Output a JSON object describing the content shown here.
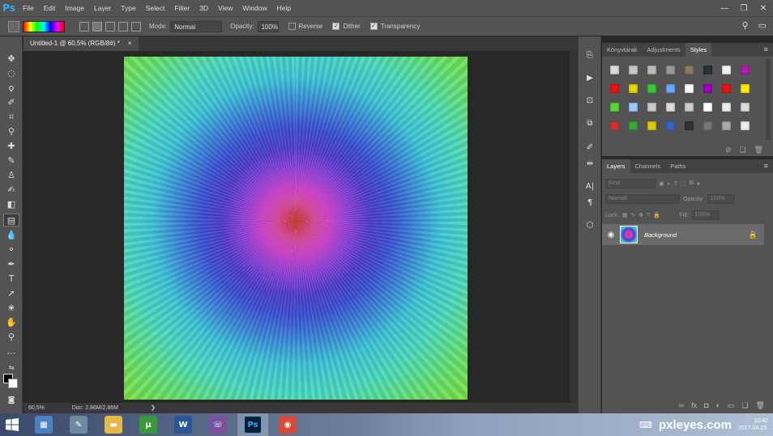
{
  "app": {
    "logo": "Ps"
  },
  "menu": [
    "File",
    "Edit",
    "Image",
    "Layer",
    "Type",
    "Select",
    "Filter",
    "3D",
    "View",
    "Window",
    "Help"
  ],
  "window_controls": [
    "—",
    "❐",
    "✕"
  ],
  "options": {
    "mode_label": "Mode:",
    "mode_value": "Normal",
    "opacity_label": "Opacity:",
    "opacity_value": "100%",
    "reverse": "Reverse",
    "dither": "Dither",
    "transparency": "Transparency",
    "reverse_checked": false,
    "dither_checked": true,
    "transparency_checked": true,
    "gradient_colors": [
      "#ff0000",
      "#ffff00",
      "#00ff00",
      "#00ffff",
      "#0000ff",
      "#ff00ff",
      "#ff0000"
    ]
  },
  "document": {
    "tab_title": "Untitled-1 @ 60,5% (RGB/8#) *",
    "close": "×"
  },
  "status": {
    "zoom": "60,5%",
    "doc": "Doc: 2,86M/2,86M",
    "arrow": "❯"
  },
  "styles_panel": {
    "tabs": [
      "Könyvtárak",
      "Adjustments",
      "Styles"
    ],
    "active_tab": "Styles",
    "swatches": [
      "#dcdcdc",
      "#c8c8c8",
      "#bbbbbb",
      "#999999",
      "#8a7a60",
      "#2a2f3a",
      "#f4f4f4",
      "#b01cb0",
      "#ee1111",
      "#e6d800",
      "#33cc33",
      "#66aaff",
      "#ffffff",
      "#9900bb",
      "#ee1111",
      "#ffee00",
      "#55dd33",
      "#99ccff",
      "#cccccc",
      "#dddddd",
      "#cccccc",
      "#ffffff",
      "#eeeeee",
      "#dddddd",
      "#cc3333",
      "#33aa33",
      "#ddcc00",
      "#3366cc",
      "#333333",
      "#777777",
      "#aaaaaa",
      "#eeeeee"
    ]
  },
  "layers_panel": {
    "tabs": [
      "Layers",
      "Channels",
      "Paths"
    ],
    "active_tab": "Layers",
    "kind": "Kind",
    "blend": "Normal",
    "opacity_label": "Opacity:",
    "opacity_value": "100%",
    "lock_label": "Lock:",
    "fill_label": "Fill:",
    "fill_value": "100%",
    "layer_name": "Background"
  },
  "taskbar": {
    "apps": [
      {
        "name": "calculator",
        "glyph": "▦",
        "color": "#4a7fc1"
      },
      {
        "name": "notes",
        "glyph": "✎",
        "color": "#6c8aa0"
      },
      {
        "name": "explorer",
        "glyph": "▬",
        "color": "#e7b74a"
      },
      {
        "name": "utorrent",
        "glyph": "µ",
        "color": "#3a9a3a"
      },
      {
        "name": "word",
        "glyph": "W",
        "color": "#2b5797"
      },
      {
        "name": "viber",
        "glyph": "☏",
        "color": "#7b519d"
      },
      {
        "name": "photoshop",
        "glyph": "Ps",
        "color": "#0a1e30"
      },
      {
        "name": "chrome",
        "glyph": "◉",
        "color": "#d64a3a"
      }
    ],
    "active_app": "photoshop",
    "watermark": "pxleyes.com",
    "time": "10:42",
    "date": "2017.04.23."
  }
}
